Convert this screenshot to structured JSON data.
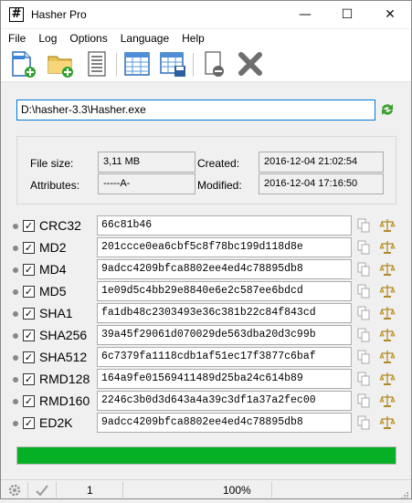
{
  "window": {
    "title": "Hasher Pro",
    "icon_glyph": "#"
  },
  "window_controls": {
    "minimize": "—",
    "maximize": "☐",
    "close": "✕"
  },
  "menu": [
    "File",
    "Log",
    "Options",
    "Language",
    "Help"
  ],
  "toolbar": [
    {
      "icon": "new-file-icon"
    },
    {
      "icon": "open-folder-icon"
    },
    {
      "icon": "document-icon"
    },
    {
      "icon": "table-icon"
    },
    {
      "icon": "table-save-icon"
    },
    {
      "icon": "remove-file-icon"
    },
    {
      "icon": "close-x-icon"
    }
  ],
  "path": "D:\\hasher-3.3\\Hasher.exe",
  "info": {
    "file_size_label": "File size:",
    "file_size": "3,11 MB",
    "attributes_label": "Attributes:",
    "attributes": "-----A-",
    "created_label": "Created:",
    "created": "2016-12-04 21:02:54",
    "modified_label": "Modified:",
    "modified": "2016-12-04 17:16:50"
  },
  "hashes": [
    {
      "name": "CRC32",
      "checked": true,
      "value": "66c81b46"
    },
    {
      "name": "MD2",
      "checked": true,
      "value": "201ccce0ea6cbf5c8f78bc199d118d8e"
    },
    {
      "name": "MD4",
      "checked": true,
      "value": "9adcc4209bfca8802ee4ed4c78895db8"
    },
    {
      "name": "MD5",
      "checked": true,
      "value": "1e09d5c4bb29e8840e6e2c587ee6bdcd"
    },
    {
      "name": "SHA1",
      "checked": true,
      "value": "fa1db48c2303493e36c381b22c84f843cd"
    },
    {
      "name": "SHA256",
      "checked": true,
      "value": "39a45f29061d070029de563dba20d3c99b"
    },
    {
      "name": "SHA512",
      "checked": true,
      "value": "6c7379fa1118cdb1af51ec17f3877c6baf"
    },
    {
      "name": "RMD128",
      "checked": true,
      "value": "164a9fe01569411489d25ba24c614b89"
    },
    {
      "name": "RMD160",
      "checked": true,
      "value": "2246c3b0d3d643a4a39c3df1a37a2fec00"
    },
    {
      "name": "ED2K",
      "checked": true,
      "value": "9adcc4209bfca8802ee4ed4c78895db8"
    }
  ],
  "progress": {
    "fraction": 1.0,
    "color": "#06b025"
  },
  "status": {
    "count": "1",
    "percent": "100%"
  },
  "colors": {
    "accent_border": "#0078d7",
    "progress_green": "#06b025"
  }
}
